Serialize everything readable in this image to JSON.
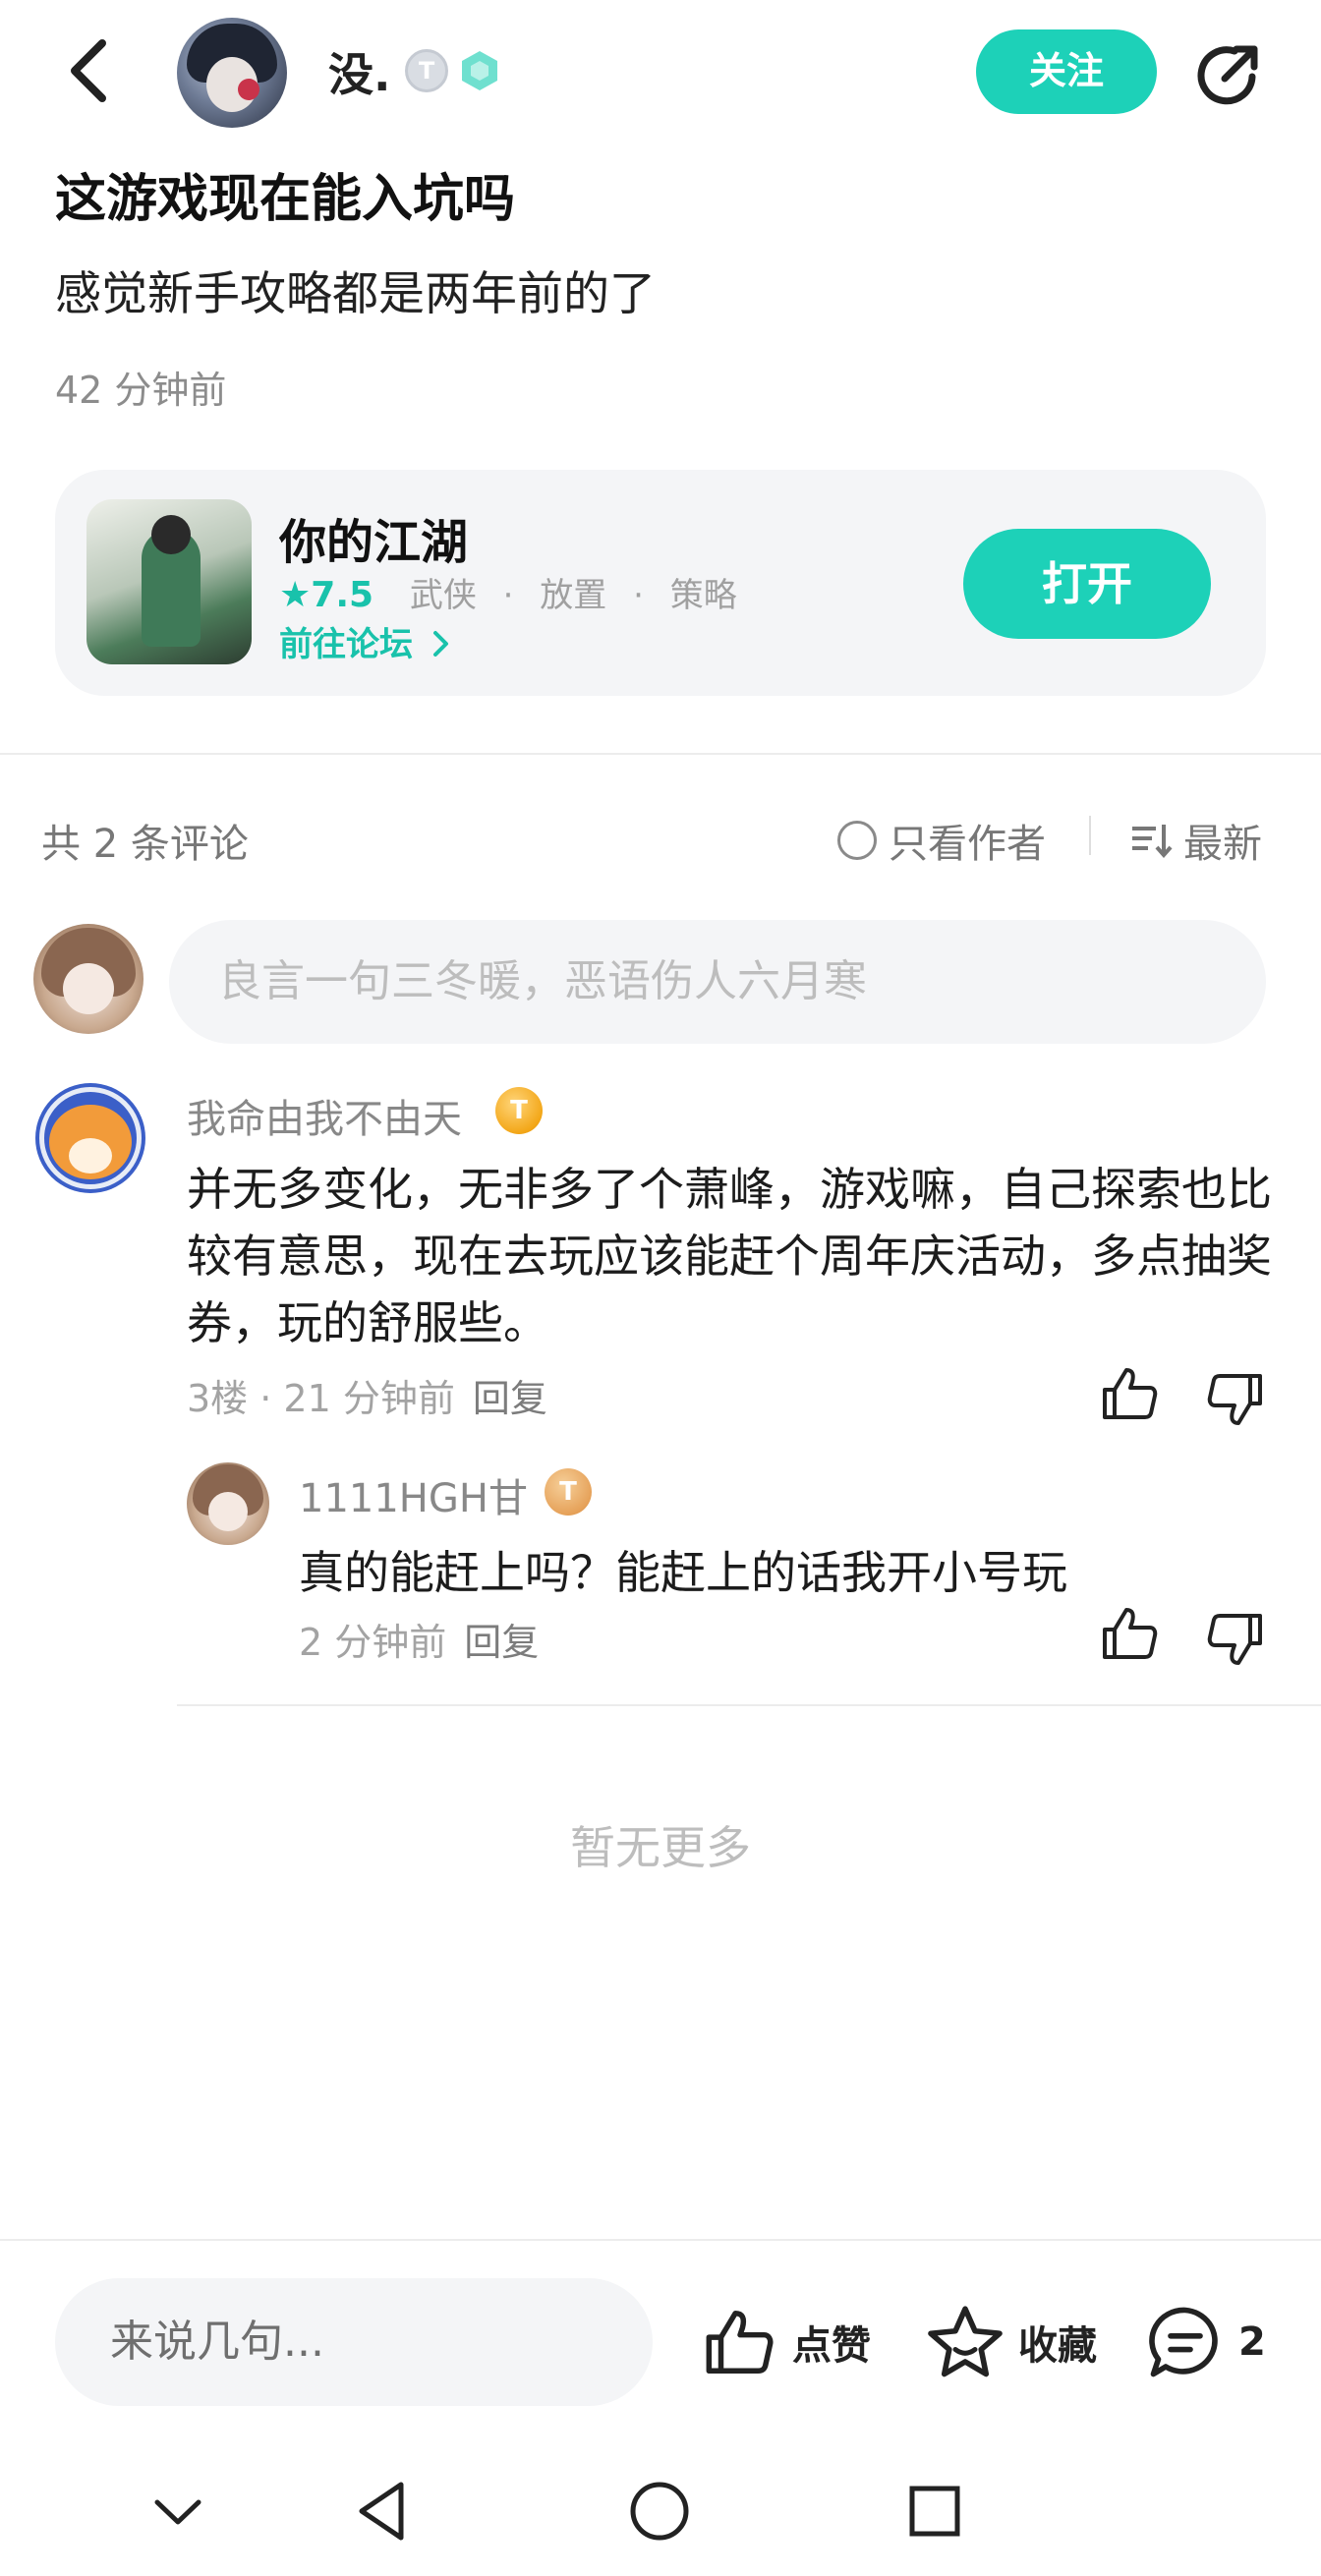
{
  "header": {
    "author_name": "没.",
    "badge_letter": "T",
    "follow_label": "关注"
  },
  "post": {
    "title": "这游戏现在能入坑吗",
    "body": "感觉新手攻略都是两年前的了",
    "time": "42 分钟前"
  },
  "game_card": {
    "name": "你的江湖",
    "rating": "★7.5",
    "tags": [
      "武侠",
      "放置",
      "策略"
    ],
    "tag_separator": "·",
    "forum_link": "前往论坛",
    "open_label": "打开"
  },
  "comments_header": {
    "count_text": "共 2 条评论",
    "author_only_label": "只看作者",
    "sort_label": "最新"
  },
  "comment_input_placeholder": "良言一句三冬暖，恶语伤人六月寒",
  "comments": [
    {
      "user": "我命由我不由天",
      "badge": "T",
      "text": "并无多变化，无非多了个萧峰，游戏嘛，自己探索也比较有意思，现在去玩应该能赶个周年庆活动，多点抽奖券，玩的舒服些。",
      "meta": "3楼 · 21 分钟前",
      "reply_label": "回复",
      "replies": [
        {
          "user": "1111HGH甘",
          "badge": "T",
          "text": "真的能赶上吗？能赶上的话我开小号玩",
          "meta": "2 分钟前",
          "reply_label": "回复"
        }
      ]
    }
  ],
  "no_more_text": "暂无更多",
  "bottom_bar": {
    "input_placeholder": "来说几句...",
    "like_label": "点赞",
    "favorite_label": "收藏",
    "comment_count": "2"
  },
  "colors": {
    "accent": "#1dd1b8",
    "accent_text": "#19c2ab",
    "muted": "#8c8c8c",
    "badge_gold": "#f3a719"
  },
  "icons": [
    "back-arrow-icon",
    "share-icon",
    "star-icon",
    "chevron-right-icon",
    "radio-icon",
    "sort-icon",
    "thumbs-up-icon",
    "thumbs-down-icon",
    "star-outline-icon",
    "comment-bubble-icon",
    "nav-down-icon",
    "nav-back-icon",
    "nav-home-icon",
    "nav-recents-icon"
  ]
}
